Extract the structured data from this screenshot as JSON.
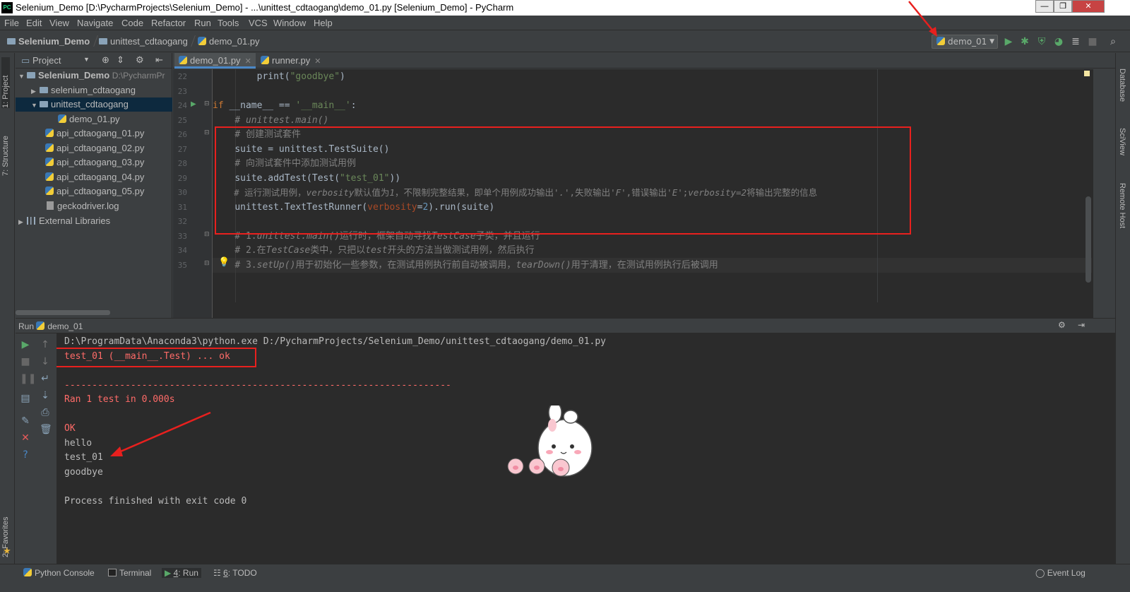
{
  "window": {
    "title": "Selenium_Demo [D:\\PycharmProjects\\Selenium_Demo] - ...\\unittest_cdtaogang\\demo_01.py [Selenium_Demo] - PyCharm",
    "logo": "PC"
  },
  "menu": [
    "File",
    "Edit",
    "View",
    "Navigate",
    "Code",
    "Refactor",
    "Run",
    "Tools",
    "VCS",
    "Window",
    "Help"
  ],
  "breadcrumb": [
    "Selenium_Demo",
    "unittest_cdtaogang",
    "demo_01.py"
  ],
  "toolbar": {
    "run_config": "demo_01"
  },
  "left_strip": {
    "project_tab": "1: Project",
    "structure_tab": "7: Structure",
    "favorites_tab": "2: Favorites"
  },
  "right_strip": {
    "database_tab": "Database",
    "sciview_tab": "SciView",
    "remote_host_tab": "Remote Host"
  },
  "project": {
    "header": "Project",
    "tree": [
      {
        "label": "Selenium_Demo",
        "path": "D:\\PycharmPr"
      },
      {
        "label": "selenium_cdtaogang"
      },
      {
        "label": "unittest_cdtaogang"
      },
      {
        "label": "demo_01.py"
      },
      {
        "label": "api_cdtaogang_01.py"
      },
      {
        "label": "api_cdtaogang_02.py"
      },
      {
        "label": "api_cdtaogang_03.py"
      },
      {
        "label": "api_cdtaogang_04.py"
      },
      {
        "label": "api_cdtaogang_05.py"
      },
      {
        "label": "geckodriver.log"
      },
      {
        "label": "External Libraries"
      }
    ]
  },
  "editor": {
    "tabs": [
      "demo_01.py",
      "runner.py"
    ],
    "line_numbers": [
      "22",
      "23",
      "24",
      "25",
      "26",
      "27",
      "28",
      "29",
      "30",
      "31",
      "32",
      "33",
      "34",
      "35"
    ],
    "lines": {
      "l22_a": "print(",
      "l22_b": "\"goodbye\"",
      "l22_c": ")",
      "l24_a": "if ",
      "l24_b": "__name__",
      "l24_c": " == ",
      "l24_d": "'__main__'",
      "l24_e": ":",
      "l25": "# unittest.main()",
      "l26": "# 创建测试套件",
      "l27": "suite = unittest.TestSuite()",
      "l28": "# 向测试套件中添加测试用例",
      "l29_a": "suite.addTest(Test(",
      "l29_b": "\"test_01\"",
      "l29_c": "))",
      "l30_a": "# 运行测试用例，",
      "l30_b": "verbosity",
      "l30_c": "默认值为",
      "l30_d": "1",
      "l30_e": "，不限制完整结果，即单个用例成功输出'",
      "l30_f": ".",
      "l30_g": "',失败输出'",
      "l30_h": "F",
      "l30_i": "',错误输出'",
      "l30_j": "E",
      "l30_k": "';",
      "l30_l": "verbosity=2",
      "l30_m": "将输出完整的信息",
      "l31_a": "unittest.TextTestRunner(",
      "l31_b": "verbosity",
      "l31_c": "=",
      "l31_d": "2",
      "l31_e": ").run(suite)",
      "l33_a": "# 1.",
      "l33_b": "unittest.main()",
      "l33_c": "运行时，框架自动寻找",
      "l33_d": "TestCase",
      "l33_e": "子类，并且运行",
      "l34_a": "# 2.在",
      "l34_b": "TestCase",
      "l34_c": "类中，只把以",
      "l34_d": "test",
      "l34_e": "开头的方法当做测试用例，然后执行",
      "l35_a": "# 3.",
      "l35_b": "setUp()",
      "l35_c": "用于初始化一些参数，在测试用例执行前自动被调用，",
      "l35_d": "tearDown()",
      "l35_e": "用于清理，在测试用例执行后被调用"
    }
  },
  "run": {
    "header_label": "Run",
    "config": "demo_01",
    "console": [
      {
        "text": "D:\\ProgramData\\Anaconda3\\python.exe D:/PycharmProjects/Selenium_Demo/unittest_cdtaogang/demo_01.py",
        "type": "normal"
      },
      {
        "text": "test_01 (__main__.Test) ... ok",
        "type": "err"
      },
      {
        "text": "",
        "type": "normal"
      },
      {
        "text": "----------------------------------------------------------------------",
        "type": "err"
      },
      {
        "text": "Ran 1 test in 0.000s",
        "type": "err"
      },
      {
        "text": "",
        "type": "normal"
      },
      {
        "text": "OK",
        "type": "err"
      },
      {
        "text": "hello",
        "type": "normal"
      },
      {
        "text": "test_01",
        "type": "normal"
      },
      {
        "text": "goodbye",
        "type": "normal"
      },
      {
        "text": "",
        "type": "normal"
      },
      {
        "text": "Process finished with exit code 0",
        "type": "normal"
      }
    ]
  },
  "statusbar": {
    "python_console": "Python Console",
    "terminal": "Terminal",
    "run_num": "4",
    "run_label": ": Run",
    "todo_num": "6",
    "todo_label": ": TODO",
    "event_log": "Event Log"
  },
  "colors": {
    "annotation_red": "#e8201e",
    "keyword": "#cc7832",
    "string": "#6a8759",
    "comment": "#808080",
    "console_error": "#ff6b68",
    "selection": "#0d293e"
  }
}
